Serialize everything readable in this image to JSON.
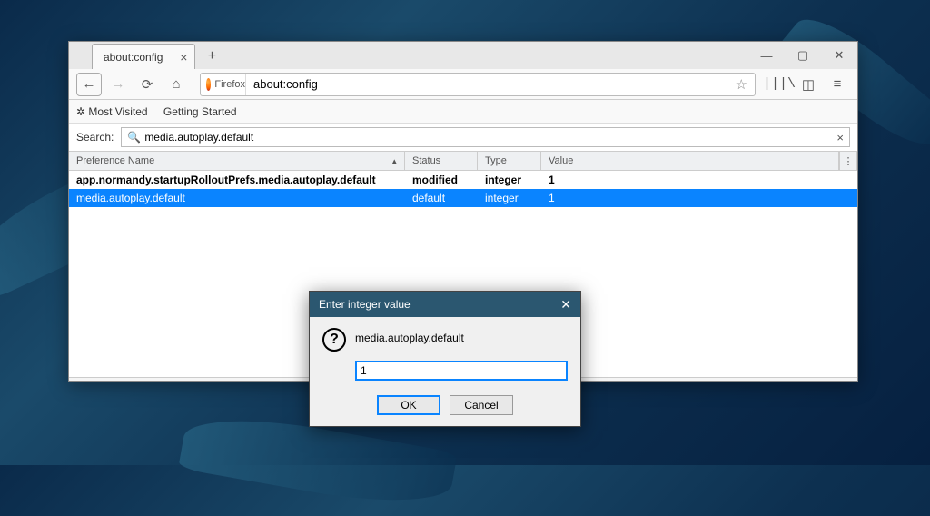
{
  "tab": {
    "title": "about:config"
  },
  "urlbar": {
    "identity": "Firefox",
    "url": "about:config"
  },
  "bookmarks": {
    "most_visited": "Most Visited",
    "getting_started": "Getting Started"
  },
  "search": {
    "label": "Search:",
    "value": "media.autoplay.default"
  },
  "columns": {
    "name": "Preference Name",
    "status": "Status",
    "type": "Type",
    "value": "Value"
  },
  "rows": [
    {
      "name": "app.normandy.startupRolloutPrefs.media.autoplay.default",
      "status": "modified",
      "type": "integer",
      "value": "1"
    },
    {
      "name": "media.autoplay.default",
      "status": "default",
      "type": "integer",
      "value": "1"
    }
  ],
  "dialog": {
    "title": "Enter integer value",
    "pref": "media.autoplay.default",
    "value": "1",
    "ok": "OK",
    "cancel": "Cancel"
  }
}
